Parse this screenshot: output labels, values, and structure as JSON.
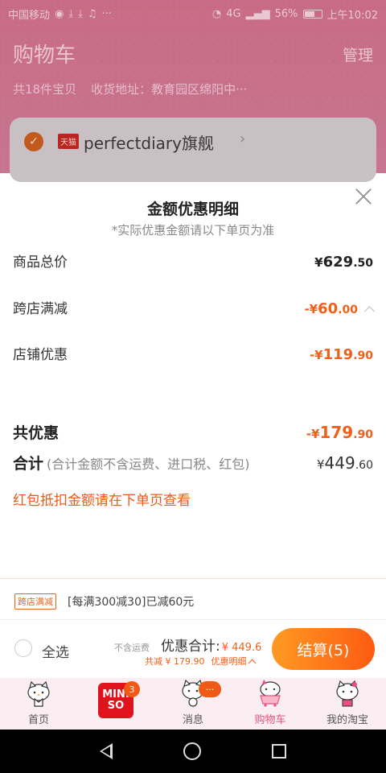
{
  "status_bar": {
    "carrier": "中国移动",
    "left_icons": [
      "notification-icon",
      "download-icon",
      "download-icon",
      "bell-icon",
      "more-icon"
    ],
    "signal": "4G",
    "battery": "56%",
    "time": "上午10:02"
  },
  "cart": {
    "title": "购物车",
    "manage": "管理",
    "count_text": "共18件宝贝",
    "address": "收货地址：教育园区绵阳中···",
    "store_badge": "天猫",
    "store_name": "perfectdiary旗舰",
    "store_arrow": "›"
  },
  "sheet": {
    "title": "金额优惠明细",
    "note": "*实际优惠金额请以下单页为准",
    "rows": [
      {
        "label": "商品总价",
        "cur": "¥",
        "int": "629",
        "dec": ".50",
        "color": "#222222"
      },
      {
        "label": "跨店满减",
        "cur": "-¥",
        "int": "60",
        "dec": ".00",
        "color": "#f0601a"
      },
      {
        "label": "店铺优惠",
        "cur": "-¥",
        "int": "119",
        "dec": ".90",
        "color": "#f0601a"
      }
    ],
    "total_discount": {
      "label": "共优惠",
      "cur": "-¥",
      "int": "179",
      "dec": ".90"
    },
    "subtotal": {
      "label": "合计",
      "note": "(合计金额不含运费、进口税、红包)",
      "cur": "¥",
      "int": "449",
      "dec": ".60"
    },
    "red_packet_note": "红包抵扣金额请在下单页查看"
  },
  "promo": {
    "tag": "跨店满减",
    "text": "[每满300减30]已减60元"
  },
  "checkout": {
    "select_all": "全选",
    "excl_shipping": "不含运费",
    "discount_total_label": "优惠合计:",
    "discount_total_amount": "¥ 449.6",
    "saved": "共减 ¥ 179.90",
    "detail_link": "优惠明细",
    "button": "结算(5)"
  },
  "tabs": [
    {
      "label": "首页"
    },
    {
      "label": "",
      "badge": "3",
      "logo_top": "MINI",
      "logo_bottom": "SO"
    },
    {
      "label": "消息",
      "badge": "···"
    },
    {
      "label": "购物车"
    },
    {
      "label": "我的淘宝"
    }
  ],
  "colors": {
    "accent": "#f0601a",
    "checkout_gradient_start": "#fe9a24",
    "checkout_gradient_end": "#fe5b11",
    "active_tab": "#e8507d"
  }
}
